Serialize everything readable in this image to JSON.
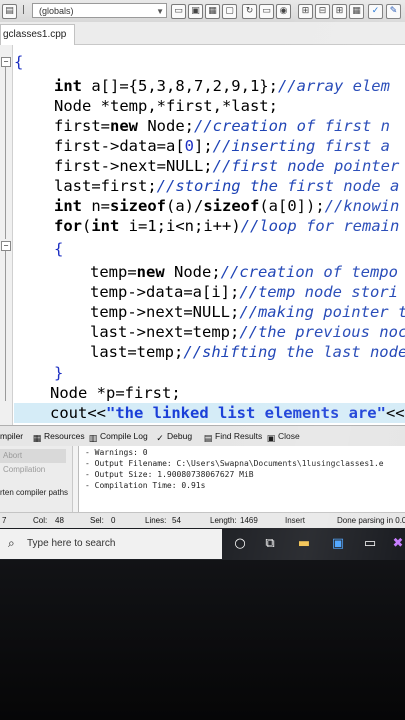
{
  "toolbar": {
    "scope_select_value": "(globals)",
    "icons": [
      "save-icon",
      "compile-icon",
      "run-icon",
      "check-icon",
      "grid-icon",
      "layout-icon",
      "tools-icon",
      "debug-icon"
    ]
  },
  "file_tab": {
    "label": "gclasses1.cpp"
  },
  "code": {
    "l1": "{",
    "l2a": "int",
    "l2b": " a[]={5,3,8,7,2,9,1};",
    "l2c": "//array elem",
    "l3": "Node *temp,*first,*last;",
    "l4a": "first=",
    "l4b": "new",
    "l4c": " Node;",
    "l4d": "//creation of first n",
    "l5a": "first->data=a[",
    "l5b": "0",
    "l5c": "];",
    "l5d": "//inserting first a",
    "l6a": "first->next=NULL;",
    "l6b": "//first node pointer",
    "l7a": "last=first;",
    "l7b": "//storing the first node a",
    "l8a": "int",
    "l8b": " n=",
    "l8c": "sizeof",
    "l8d": "(a)/",
    "l8e": "sizeof",
    "l8f": "(a[0]);",
    "l8g": "//knowin",
    "l9a": "for",
    "l9b": "(",
    "l9c": "int",
    "l9d": " i=1;i<n;i++)",
    "l9e": "//loop for remain",
    "l10": "{",
    "l11a": "temp=",
    "l11b": "new",
    "l11c": " Node;",
    "l11d": "//creation of tempo",
    "l12a": "temp->data=a[i];",
    "l12b": "//temp node stori",
    "l13a": "temp->next=NULL;",
    "l13b": "//making pointer t",
    "l14a": "last->next=temp;",
    "l14b": "//the previous noc",
    "l15a": "last=temp;",
    "l15b": "//shifting the last node",
    "l16": "}",
    "l17": "Node *p=first;",
    "l18a": "cout<<",
    "l18b": "\"the linked list elements are\"",
    "l18c": "<<"
  },
  "panel_tabs": {
    "compiler": "mpiler",
    "resources": "Resources",
    "compile_log": "Compile Log",
    "debug": "Debug",
    "find_results": "Find Results",
    "close": "Close"
  },
  "panel": {
    "abort_button": "Abort Compilation",
    "shorten_paths": "rten compiler paths",
    "log": [
      "- Warnings: 0",
      "- Output Filename: C:\\Users\\Swapna\\Documents\\1lusingclasses1.e",
      "- Output Size: 1.90080738067627 MiB",
      "- Compilation Time: 0.91s"
    ]
  },
  "status": {
    "line": "7",
    "col_label": "Col:",
    "col_value": "48",
    "sel_label": "Sel:",
    "sel_value": "0",
    "lines_label": "Lines:",
    "lines_value": "54",
    "length_label": "Length:",
    "length_value": "1469",
    "mode": "Insert",
    "message": "Done parsing in 0.0"
  },
  "taskbar": {
    "search_placeholder": "Type here to search"
  }
}
